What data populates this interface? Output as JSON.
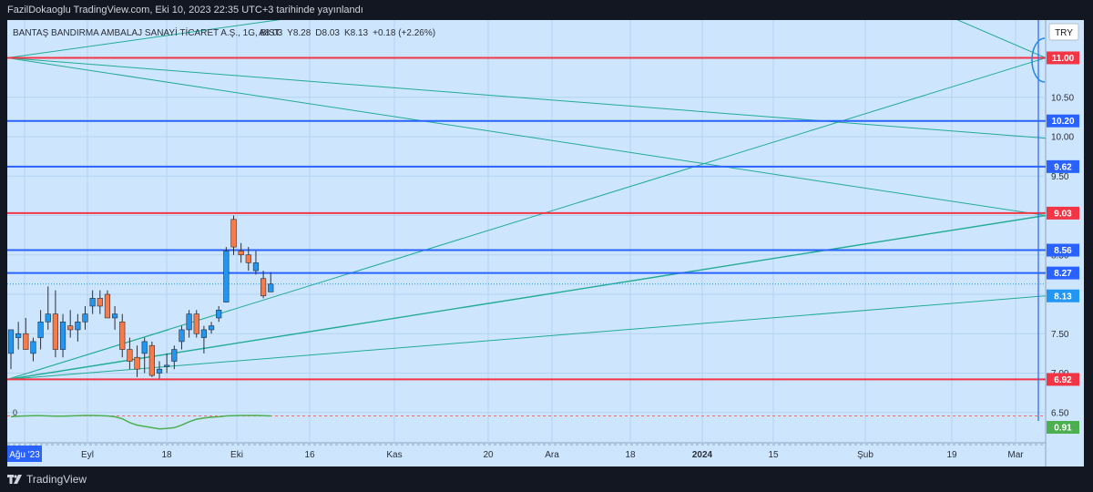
{
  "header": {
    "publish_text": "FazilDokaoglu TradingView.com, Eki 10, 2023 22:35 UTC+3 tarihinde yayınlandı"
  },
  "footer": {
    "brand": "TradingView"
  },
  "colors": {
    "bg": "#131722",
    "pane": "#cde6fd",
    "red_line": "#f23645",
    "blue_line": "#2962ff",
    "fan_line": "#22ab94",
    "oscillator": "#4caf50",
    "up_candle": "#2196f3",
    "down_candle": "#f57c4a"
  },
  "icons": [
    "tradingview-logo-icon"
  ],
  "chart_data": {
    "type": "candlestick",
    "symbol_line": "BANTAŞ BANDIRMA AMBALAJ SANAYİ TİCARET A.Ş., 1G, BIST",
    "legend_ohlc": [
      {
        "label": "A",
        "value": "8.03"
      },
      {
        "label": "Y",
        "value": "8.28"
      },
      {
        "label": "D",
        "value": "8.03"
      },
      {
        "label": "K",
        "value": "8.13"
      }
    ],
    "legend_change": "+0.18 (+2.26%)",
    "currency": "TRY",
    "ylim": [
      6.35,
      11.6
    ],
    "y_ticks": [
      "10.50",
      "10.00",
      "9.50",
      "9.00",
      "8.50",
      "8.00",
      "7.50",
      "7.00",
      "6.50"
    ],
    "x_ticks": [
      {
        "label": "Ağu '23",
        "highlight": true
      },
      {
        "label": "Eyl"
      },
      {
        "label": "18"
      },
      {
        "label": "Eki"
      },
      {
        "label": "16"
      },
      {
        "label": "Kas"
      },
      {
        "label": "20"
      },
      {
        "label": "Ara"
      },
      {
        "label": "18"
      },
      {
        "label": "2024",
        "bold": true
      },
      {
        "label": "15"
      },
      {
        "label": "Şub"
      },
      {
        "label": "19"
      },
      {
        "label": "Mar"
      }
    ],
    "candles": [
      {
        "o": 7.25,
        "h": 7.55,
        "l": 7.05,
        "c": 7.55
      },
      {
        "o": 7.45,
        "h": 7.65,
        "l": 7.3,
        "c": 7.5
      },
      {
        "o": 7.5,
        "h": 7.7,
        "l": 7.3,
        "c": 7.3
      },
      {
        "o": 7.25,
        "h": 7.45,
        "l": 7.15,
        "c": 7.4
      },
      {
        "o": 7.45,
        "h": 7.8,
        "l": 7.3,
        "c": 7.65
      },
      {
        "o": 7.65,
        "h": 8.1,
        "l": 7.55,
        "c": 7.75
      },
      {
        "o": 7.75,
        "h": 8.05,
        "l": 7.2,
        "c": 7.3
      },
      {
        "o": 7.3,
        "h": 7.75,
        "l": 7.2,
        "c": 7.65
      },
      {
        "o": 7.6,
        "h": 7.8,
        "l": 7.45,
        "c": 7.55
      },
      {
        "o": 7.55,
        "h": 7.75,
        "l": 7.4,
        "c": 7.65
      },
      {
        "o": 7.65,
        "h": 7.85,
        "l": 7.55,
        "c": 7.75
      },
      {
        "o": 7.85,
        "h": 8.05,
        "l": 7.75,
        "c": 7.95
      },
      {
        "o": 7.95,
        "h": 8.05,
        "l": 7.75,
        "c": 7.85
      },
      {
        "o": 8.0,
        "h": 8.05,
        "l": 7.7,
        "c": 7.7
      },
      {
        "o": 7.7,
        "h": 7.85,
        "l": 7.55,
        "c": 7.75
      },
      {
        "o": 7.65,
        "h": 7.75,
        "l": 7.2,
        "c": 7.3
      },
      {
        "o": 7.3,
        "h": 7.45,
        "l": 7.05,
        "c": 7.15
      },
      {
        "o": 7.2,
        "h": 7.35,
        "l": 6.95,
        "c": 7.05
      },
      {
        "o": 7.25,
        "h": 7.45,
        "l": 7.0,
        "c": 7.4
      },
      {
        "o": 7.35,
        "h": 7.4,
        "l": 6.95,
        "c": 6.97
      },
      {
        "o": 7.0,
        "h": 7.15,
        "l": 6.93,
        "c": 7.05
      },
      {
        "o": 7.1,
        "h": 7.25,
        "l": 7.0,
        "c": 7.1
      },
      {
        "o": 7.15,
        "h": 7.35,
        "l": 7.05,
        "c": 7.3
      },
      {
        "o": 7.4,
        "h": 7.6,
        "l": 7.3,
        "c": 7.55
      },
      {
        "o": 7.55,
        "h": 7.8,
        "l": 7.45,
        "c": 7.75
      },
      {
        "o": 7.75,
        "h": 7.8,
        "l": 7.45,
        "c": 7.5
      },
      {
        "o": 7.45,
        "h": 7.6,
        "l": 7.25,
        "c": 7.55
      },
      {
        "o": 7.55,
        "h": 7.65,
        "l": 7.5,
        "c": 7.6
      },
      {
        "o": 7.7,
        "h": 7.85,
        "l": 7.65,
        "c": 7.8
      },
      {
        "o": 7.9,
        "h": 8.6,
        "l": 7.9,
        "c": 8.55
      },
      {
        "o": 8.95,
        "h": 9.0,
        "l": 8.5,
        "c": 8.6
      },
      {
        "o": 8.55,
        "h": 8.65,
        "l": 8.4,
        "c": 8.5
      },
      {
        "o": 8.5,
        "h": 8.6,
        "l": 8.3,
        "c": 8.4
      },
      {
        "o": 8.3,
        "h": 8.55,
        "l": 8.25,
        "c": 8.4
      },
      {
        "o": 8.2,
        "h": 8.3,
        "l": 7.95,
        "c": 7.98
      },
      {
        "o": 8.03,
        "h": 8.28,
        "l": 8.03,
        "c": 8.13
      }
    ],
    "horizontal_levels": [
      {
        "value": 11.0,
        "label": "11.00",
        "color": "red"
      },
      {
        "value": 10.2,
        "label": "10.20",
        "color": "blue"
      },
      {
        "value": 9.62,
        "label": "9.62",
        "color": "blue"
      },
      {
        "value": 9.03,
        "label": "9.03",
        "color": "red"
      },
      {
        "value": 8.56,
        "label": "8.56",
        "color": "blue"
      },
      {
        "value": 8.27,
        "label": "8.27",
        "color": "blue"
      },
      {
        "value": 6.92,
        "label": "6.92",
        "color": "red"
      }
    ],
    "last_price_label": "8.13",
    "oscillator": {
      "value_label": "0.91",
      "zero_label": "0",
      "series": [
        0.88,
        0.9,
        0.91,
        0.92,
        0.92,
        0.91,
        0.9,
        0.9,
        0.91,
        0.92,
        0.93,
        0.93,
        0.92,
        0.91,
        0.88,
        0.8,
        0.65,
        0.55,
        0.5,
        0.45,
        0.4,
        0.42,
        0.45,
        0.55,
        0.68,
        0.78,
        0.83,
        0.86,
        0.88,
        0.91,
        0.92,
        0.93,
        0.93,
        0.93,
        0.92,
        0.91
      ]
    }
  }
}
